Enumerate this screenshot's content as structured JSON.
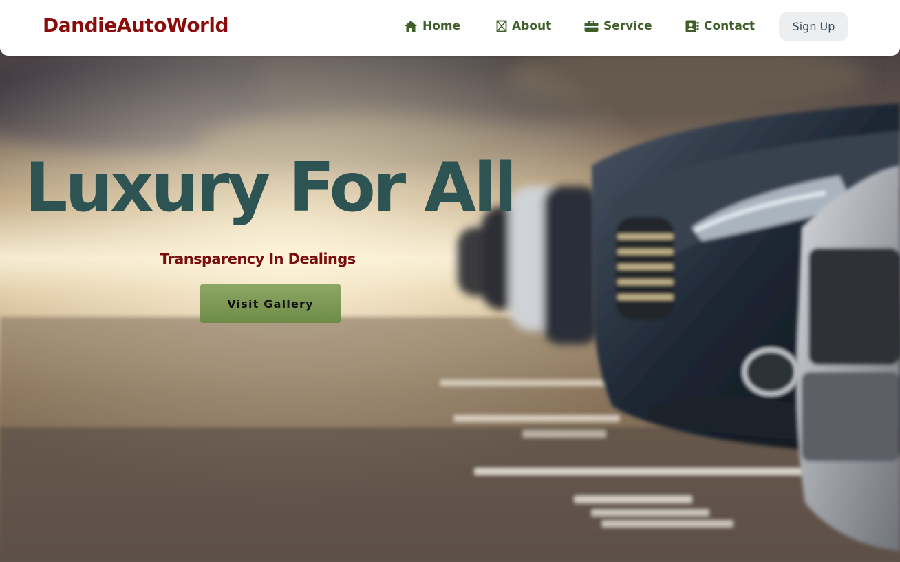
{
  "navbar": {
    "brand": "DandieAutoWorld",
    "links": [
      {
        "label": "Home",
        "icon": "home-icon"
      },
      {
        "label": "About",
        "icon": "about-icon"
      },
      {
        "label": "Service",
        "icon": "briefcase-icon"
      },
      {
        "label": "Contact",
        "icon": "contact-book-icon"
      }
    ],
    "signup_label": "Sign Up"
  },
  "hero": {
    "title": "Luxury For All",
    "subtitle": "Transparency In Dealings",
    "cta_label": "Visit Gallery",
    "background": "cars-parking-lot-image"
  },
  "colors": {
    "brand": "#8b0b0b",
    "nav_link": "#3f5f2a",
    "hero_title": "#2d5353",
    "hero_subtitle": "#7a0c0c",
    "cta_bg": "#7d9a55"
  }
}
